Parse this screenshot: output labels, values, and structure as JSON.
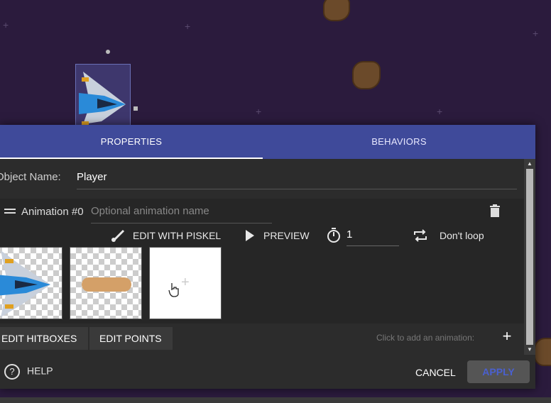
{
  "tabs": {
    "properties": "PROPERTIES",
    "behaviors": "BEHAVIORS"
  },
  "object": {
    "name_label": "Object Name:",
    "name_value": "Player"
  },
  "animation": {
    "label": "Animation #0",
    "name_placeholder": "Optional animation name",
    "toolbar": {
      "edit_piskel": "EDIT WITH PISKEL",
      "preview": "PREVIEW",
      "fps_value": "1",
      "loop": "Don't loop"
    }
  },
  "buttons": {
    "edit_hitboxes": "EDIT HITBOXES",
    "edit_points": "EDIT POINTS"
  },
  "add_animation": {
    "label": "Click to add an animation:",
    "plus": "+"
  },
  "footer": {
    "help": "HELP",
    "cancel": "CANCEL",
    "apply": "APPLY"
  },
  "colors": {
    "accent": "#3f4a9a",
    "dialog_bg": "#2c2c2c",
    "scene_bg": "#2b1b3d"
  },
  "icons": [
    "brush-icon",
    "play-icon",
    "timer-icon",
    "repeat-icon",
    "trash-icon",
    "help-icon",
    "drag-handle-icon",
    "plus-icon"
  ]
}
